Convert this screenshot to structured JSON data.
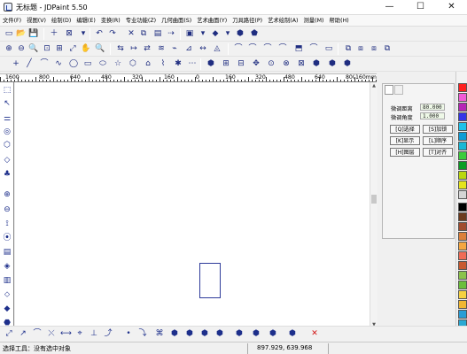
{
  "window": {
    "title": "无标题 - JDPaint 5.50",
    "minimize": "—",
    "maximize": "☐",
    "close": "✕"
  },
  "menus": [
    "文件(F)",
    "视图(V)",
    "绘制(D)",
    "编辑(E)",
    "变换(R)",
    "专业功能(Z)",
    "几何曲面(S)",
    "艺术曲面(Y)",
    "刀具路径(P)",
    "艺术绘制(A)",
    "测量(M)",
    "帮助(H)"
  ],
  "toolbars": {
    "row1": [
      "▭",
      "📂",
      "💾",
      "＋",
      "⊠",
      "▾",
      "↶",
      "↷",
      "✕",
      "⧉",
      "▤",
      "⇢",
      "▾",
      "▣",
      "▾",
      "◆",
      "▾",
      "⬢",
      "⬟"
    ],
    "row2": [
      "⊕",
      "⊖",
      "🔍",
      "⊡",
      "⊞",
      "⤢",
      "✋",
      "🔍",
      "⇆",
      "↦",
      "⇄",
      "≋",
      "⌁",
      "⊿",
      "↔",
      "◬",
      "⌒",
      "⌒",
      "⌒",
      "⌒",
      "⬒",
      "⌒",
      "▭",
      "⧉",
      "⧈",
      "⧈",
      "⧉"
    ],
    "row3": [
      "+",
      "╱",
      "⌒",
      "∿",
      "◯",
      "▭",
      "⬭",
      "☆",
      "⬡",
      "⌂",
      "⌇",
      "✱",
      "⋯",
      "⬢",
      "⊞",
      "⊟",
      "✥",
      "⊙",
      "⊗",
      "⊠",
      "⬢",
      "⬢",
      "⬢"
    ]
  },
  "ruler": {
    "labels": [
      "1600",
      "800",
      "640",
      "480",
      "320",
      "160",
      "0",
      "160",
      "320",
      "480",
      "640",
      "800",
      "160mm"
    ]
  },
  "left_tools": [
    "⬚",
    "↖",
    "⚌",
    "◎",
    "⬡",
    "◇",
    "♣",
    "⊕",
    "⊖",
    "⟟",
    "⦿",
    "▤",
    "◈",
    "▥",
    "⬦",
    "◆",
    "⬣",
    "⬣",
    "▣",
    "▦",
    "⬢"
  ],
  "panel": {
    "distance_label": "微调距离",
    "distance_value": "80.000",
    "angle_label": "微调角度",
    "angle_value": "1.000",
    "buttons": [
      "[Q]选择",
      "[S]加锁",
      "[K]显示",
      "[L]顺序",
      "[H]图层",
      "[T]对齐"
    ]
  },
  "colors": {
    "accent": "#1d2f8b",
    "selection": "#eef8e7",
    "status": "#000000"
  },
  "palette": [
    "#ff1f1f",
    "#f15ad6",
    "#b626b6",
    "#3535e8",
    "#1ec1e9",
    "#109cd6",
    "#19b8d6",
    "#3bcc3b",
    "#0b9c24",
    "#bad70f",
    "#e4e41d",
    "#d5d5d5",
    "#000000",
    "#6c3a1d",
    "#a04c2f",
    "#dc803b",
    "#f4a640",
    "#ef6b56",
    "#c75930",
    "#8bc34a",
    "#6bbf3a",
    "#f5d142",
    "#f0b733",
    "#2a9dd6",
    "#2ba8d3",
    "#aa4ad9"
  ],
  "bottom_tools": [
    "⤢",
    "↗",
    "⌒",
    "⤬",
    "⟷",
    "⌖",
    "⊥",
    "⤴",
    "•",
    "⤵",
    "⌘",
    "⬢",
    "⬢",
    "⬢",
    "⬢",
    "⬢",
    "⬢",
    "⬢",
    "⬢",
    "✕"
  ],
  "status": {
    "left": "选择工具：没有选中对象",
    "coordinates": "897.929, 639.968"
  }
}
